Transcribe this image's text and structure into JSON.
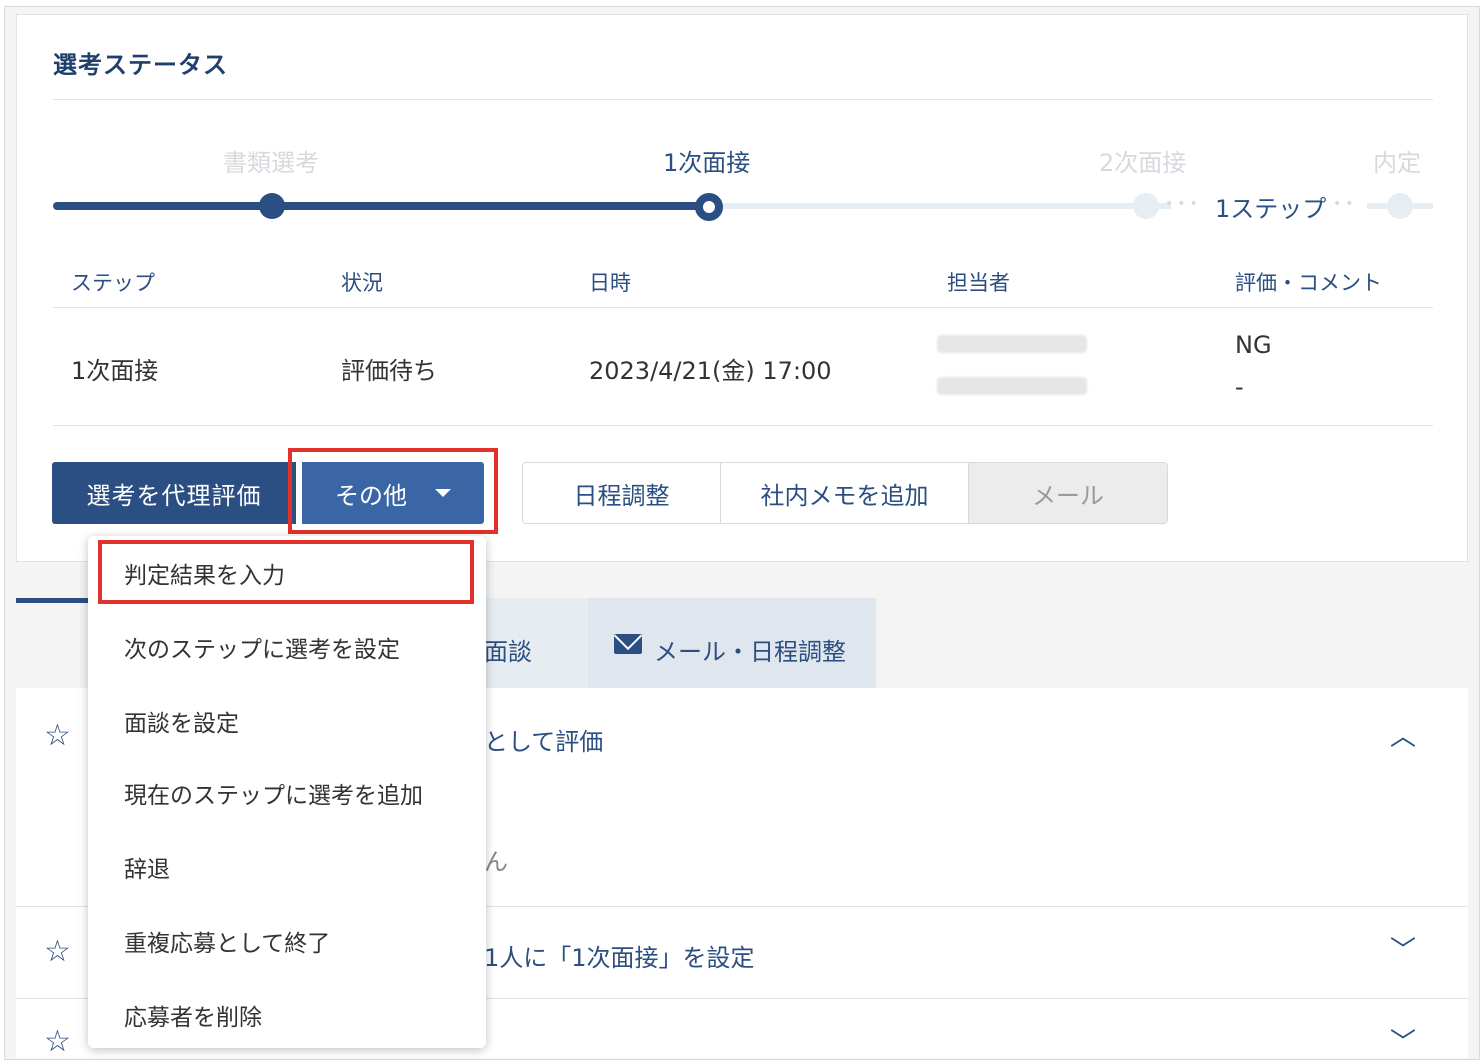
{
  "card": {
    "title": "選考ステータス"
  },
  "progress": {
    "steps": [
      "書類選考",
      "1次面接",
      "2次面接",
      "内定"
    ],
    "skip_label": "1ステップ"
  },
  "table": {
    "headers": [
      "ステップ",
      "状況",
      "日時",
      "担当者",
      "評価・コメント"
    ],
    "row": {
      "step": "1次面接",
      "status": "評価待ち",
      "datetime": "2023/4/21(金) 17:00",
      "evaluation": "NG",
      "comment": "-"
    }
  },
  "actions": {
    "proxy_evaluate": "選考を代理評価",
    "other": "その他",
    "schedule": "日程調整",
    "add_memo": "社内メモを追加",
    "mail": "メール"
  },
  "tabs": {
    "partial_interview": "面談",
    "mail_schedule": "メール・日程調整"
  },
  "list": {
    "item1_text": "として評価",
    "item1_sub": "ん",
    "item2_text": "1人に「1次面接」を設定"
  },
  "dropdown": {
    "items": [
      "判定結果を入力",
      "次のステップに選考を設定",
      "面談を設定",
      "現在のステップに選考を追加",
      "辞退",
      "重複応募として終了",
      "応募者を削除"
    ]
  },
  "colors": {
    "accent": "#2b4f82",
    "highlight": "#e0312a"
  }
}
